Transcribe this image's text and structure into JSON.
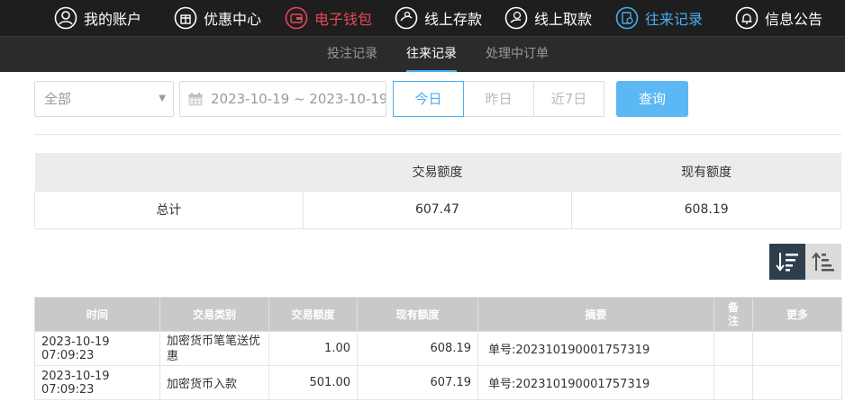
{
  "nav": {
    "items": [
      {
        "label": "我的账户",
        "icon": "user-icon"
      },
      {
        "label": "优惠中心",
        "icon": "gift-icon"
      },
      {
        "label": "电子钱包",
        "icon": "wallet-icon",
        "color": "#e8475a"
      },
      {
        "label": "线上存款",
        "icon": "deposit-icon"
      },
      {
        "label": "线上取款",
        "icon": "withdraw-icon"
      },
      {
        "label": "往来记录",
        "icon": "records-icon",
        "color": "#48aef0"
      },
      {
        "label": "信息公告",
        "icon": "bell-icon"
      }
    ]
  },
  "subnav": {
    "tabs": [
      "投注记录",
      "往来记录",
      "处理中订单"
    ],
    "active": "往来记录"
  },
  "filters": {
    "type_select": "全部",
    "date_range": "2023-10-19 ~ 2023-10-19",
    "quick": [
      "今日",
      "昨日",
      "近7日"
    ],
    "query_label": "查询"
  },
  "summary": {
    "headers": [
      "",
      "交易额度",
      "现有额度"
    ],
    "row": {
      "label": "总计",
      "amount": "607.47",
      "balance": "608.19"
    }
  },
  "detail": {
    "headers": [
      "时间",
      "交易类别",
      "交易额度",
      "现有额度",
      "摘要",
      "备注",
      "更多"
    ],
    "rows": [
      {
        "time": "2023-10-19 07:09:23",
        "type": "加密货币笔笔送优惠",
        "amount": "1.00",
        "balance": "608.19",
        "summary": "单号:202310190001757319",
        "remark": "",
        "more": ""
      },
      {
        "time": "2023-10-19 07:09:23",
        "type": "加密货币入款",
        "amount": "501.00",
        "balance": "607.19",
        "summary": "单号:202310190001757319",
        "remark": "",
        "more": ""
      }
    ]
  },
  "colors": {
    "accent": "#48aef0",
    "wallet": "#e8475a",
    "nav_bg": "#1e1e1e",
    "sort_active": "#2f3e4c"
  }
}
